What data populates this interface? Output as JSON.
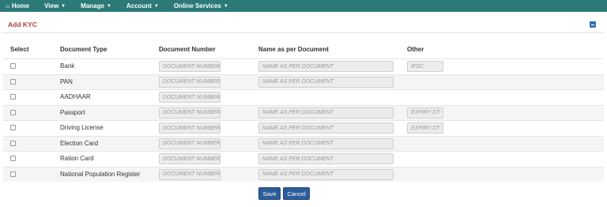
{
  "nav": {
    "home": "Home",
    "view": "View",
    "manage": "Manage",
    "account": "Account",
    "online_services": "Online Services"
  },
  "panel": {
    "title": "Add KYC"
  },
  "table": {
    "headers": {
      "select": "Select",
      "doc_type": "Document Type",
      "doc_number": "Document Number",
      "name": "Name as per Document",
      "other": "Other"
    },
    "placeholders": {
      "doc_number": "DOCUMENT NUMBER",
      "name": "NAME AS PER DOCUMENT"
    },
    "rows": [
      {
        "doc_type": "Bank",
        "other": "IFSC"
      },
      {
        "doc_type": "PAN"
      },
      {
        "doc_type": "AADHAAR"
      },
      {
        "doc_type": "Passport",
        "other": "EXPIRY DT"
      },
      {
        "doc_type": "Driving License",
        "other": "EXPIRY DT"
      },
      {
        "doc_type": "Election Card"
      },
      {
        "doc_type": "Ration Card"
      },
      {
        "doc_type": "National Population Register"
      }
    ]
  },
  "actions": {
    "save": "Save",
    "cancel": "Cancel"
  },
  "colors": {
    "navbar": "#2b7a78",
    "title": "#b0413e",
    "button": "#2d5c9a"
  }
}
